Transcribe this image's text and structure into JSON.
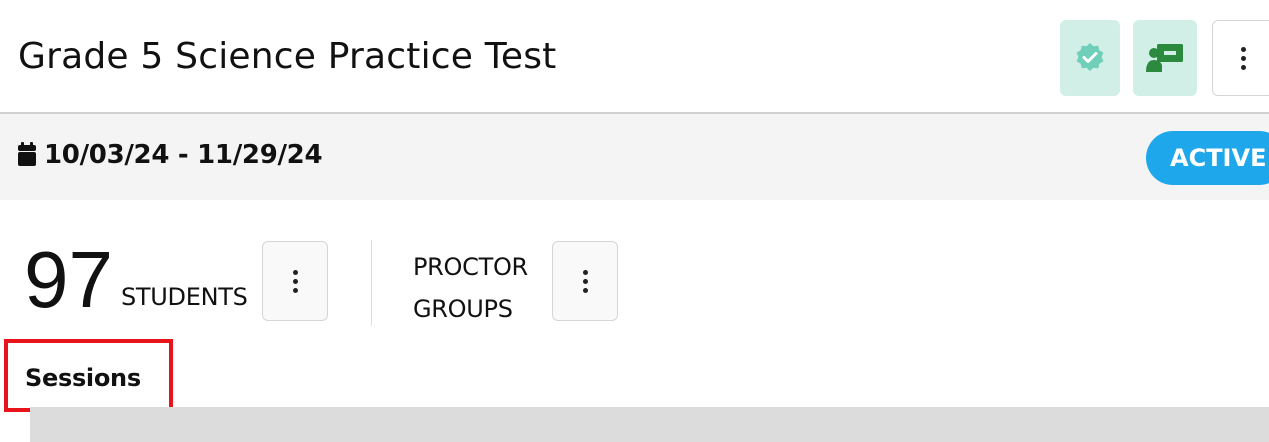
{
  "header": {
    "title": "Grade 5 Science Practice Test",
    "buttons": {
      "verified_icon": "verified-badge-icon",
      "board_icon": "teacher-board-icon",
      "more_icon": "vertical-dots-icon"
    }
  },
  "dates": {
    "icon": "calendar-icon",
    "range": "10/03/24 - 11/29/24",
    "status": "ACTIVE"
  },
  "stats": {
    "student_count": "97",
    "students_label": "STUDENTS",
    "proctor_line1": "PROCTOR",
    "proctor_line2": "GROUPS"
  },
  "sessions": {
    "label": "Sessions"
  },
  "colors": {
    "accent_teal": "#d1efe7",
    "icon_green": "#2b8a3e",
    "badge_blue": "#1ea7ea",
    "highlight_red": "#e8141b"
  }
}
